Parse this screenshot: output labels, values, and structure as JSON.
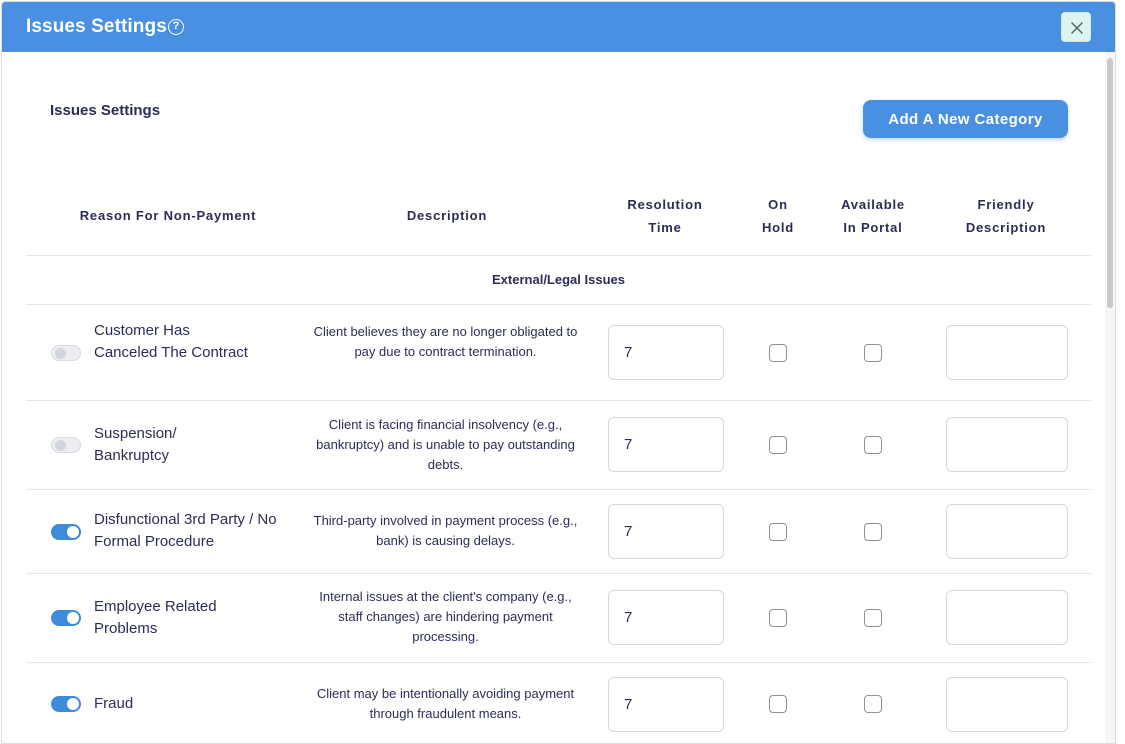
{
  "modal": {
    "title": "Issues Settings",
    "help_glyph": "?",
    "close_icon": "close-icon"
  },
  "content": {
    "section_title": "Issues Settings",
    "add_button_label": "Add A New Category"
  },
  "table": {
    "headers": {
      "reason": "Reason For Non-Payment",
      "description": "Description",
      "resolution_line1": "Resolution",
      "resolution_line2": "Time",
      "onhold_line1": "On",
      "onhold_line2": "Hold",
      "portal_line1": "Available",
      "portal_line2": "In Portal",
      "friendly_line1": "Friendly",
      "friendly_line2": "Description"
    },
    "group_title": "External/Legal Issues",
    "rows": [
      {
        "enabled": false,
        "reason": "Customer Has Canceled The Contract",
        "description": "Client believes they are no longer obligated to pay due to contract termination.",
        "resolution_time": "7",
        "on_hold": false,
        "available_in_portal": false,
        "friendly_description": ""
      },
      {
        "enabled": false,
        "reason": "Suspension/ Bankruptcy",
        "description": "Client is facing financial insolvency (e.g., bankruptcy) and is unable to pay outstanding debts.",
        "resolution_time": "7",
        "on_hold": false,
        "available_in_portal": false,
        "friendly_description": ""
      },
      {
        "enabled": true,
        "reason": "Disfunctional 3rd Party / No Formal Procedure",
        "description": "Third-party involved in payment process (e.g., bank) is causing delays.",
        "resolution_time": "7",
        "on_hold": false,
        "available_in_portal": false,
        "friendly_description": ""
      },
      {
        "enabled": true,
        "reason": "Employee Related Problems",
        "description": "Internal issues at the client's company (e.g., staff changes) are hindering payment processing.",
        "resolution_time": "7",
        "on_hold": false,
        "available_in_portal": false,
        "friendly_description": ""
      },
      {
        "enabled": true,
        "reason": "Fraud",
        "description": "Client may be intentionally avoiding payment through fraudulent means.",
        "resolution_time": "7",
        "on_hold": false,
        "available_in_portal": false,
        "friendly_description": ""
      }
    ]
  },
  "colors": {
    "header_bg": "#4a90e2",
    "toggle_on": "#3e8bdc",
    "text": "#2b2d55"
  }
}
